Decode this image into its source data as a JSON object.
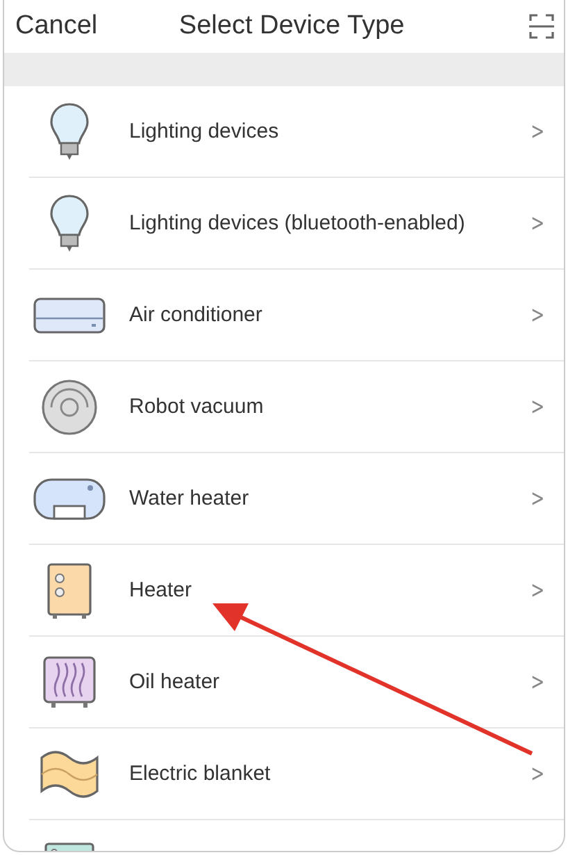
{
  "header": {
    "cancel": "Cancel",
    "title": "Select Device Type"
  },
  "devices": [
    {
      "kind": "bulb",
      "label": "Lighting devices",
      "chevron": ">"
    },
    {
      "kind": "bulb",
      "label": "Lighting devices (bluetooth-enabled)",
      "chevron": ">"
    },
    {
      "kind": "aircon",
      "label": "Air conditioner",
      "chevron": ">"
    },
    {
      "kind": "vacuum",
      "label": "Robot vacuum",
      "chevron": ">"
    },
    {
      "kind": "waterheater",
      "label": "Water heater",
      "chevron": ">"
    },
    {
      "kind": "heater",
      "label": "Heater",
      "chevron": ">"
    },
    {
      "kind": "oilheater",
      "label": "Oil heater",
      "chevron": ">"
    },
    {
      "kind": "blanket",
      "label": "Electric blanket",
      "chevron": ">"
    },
    {
      "kind": "partial"
    }
  ]
}
